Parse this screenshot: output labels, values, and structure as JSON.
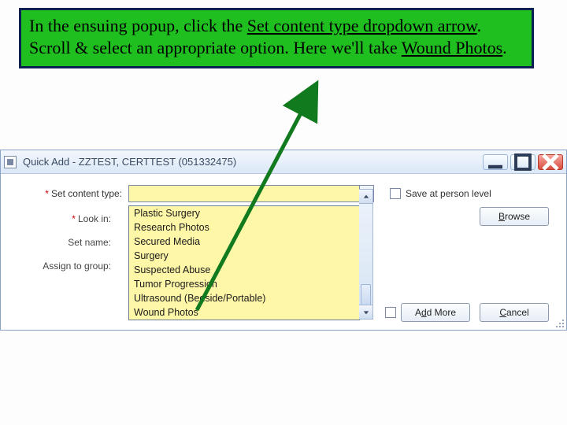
{
  "instruction": {
    "p1": "In the ensuing popup, click the ",
    "u1": "Set content type dropdown arrow",
    "p2": ".  Scroll & select an appropriate option.  Here we'll take ",
    "u2": "Wound Photos",
    "p3": "."
  },
  "dialog": {
    "title": "Quick Add - ZZTEST, CERTTEST (051332475)",
    "labels": {
      "contentType": "Set content type:",
      "lookIn": "Look in:",
      "setName": "Set name:",
      "assignGroup": "Assign to group:"
    },
    "checkbox": "Save at person level",
    "buttons": {
      "browse": "Browse",
      "addMore": "Add More",
      "cancel": "Cancel"
    },
    "options": [
      "Plastic Surgery",
      "Research Photos",
      "Secured Media",
      "Surgery",
      "Suspected Abuse",
      "Tumor Progression",
      "Ultrasound (Bedside/Portable)",
      "Wound Photos"
    ]
  }
}
